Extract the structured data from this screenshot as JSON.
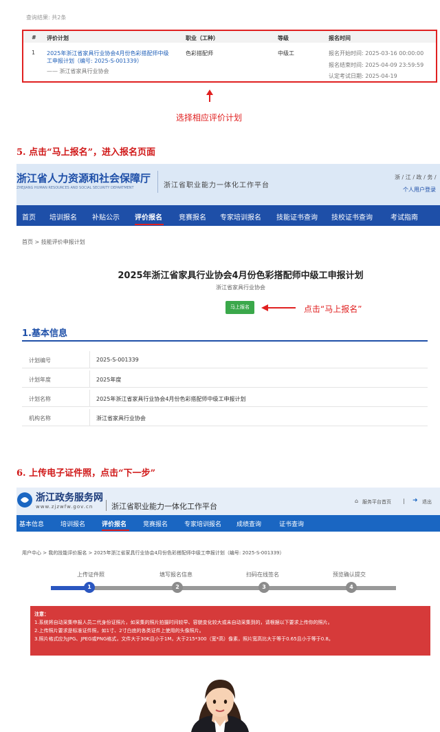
{
  "result": {
    "count_label": "查询结果: 共2条",
    "headers": [
      "#",
      "评价计划",
      "职业（工种）",
      "等级",
      "报名时间"
    ],
    "row": {
      "index": "1",
      "plan_line1": "2025年浙江省家具行业协会4月份色彩搭配师中级",
      "plan_line2": "工申报计划（编号: 2025-S-001339）",
      "org": "—— 浙江省家具行业协会",
      "occupation": "色彩搭配师",
      "level": "中级工",
      "time1": "报名开始时间: 2025-03-16 00:00:00",
      "time2": "报名结束时间: 2025-04-09 23:59:59",
      "time3": "认定考试日期: 2025-04-19"
    },
    "annotation": "选择相应评价计划"
  },
  "step5": {
    "title": "5.  点击“马上报名”，进入报名页面",
    "header": {
      "org_name": "浙江省人力资源和社会保障厅",
      "org_en": "ZHEJIANG HUMAN RESOURCES AND SOCIAL SECURITY DEPARTMENT",
      "platform": "浙江省职业能力一体化工作平台",
      "gov_links": "浙 / 江 / 政 / 务 /",
      "login": "个人用户登录"
    },
    "nav": [
      "首页",
      "培训报名",
      "补贴公示",
      "评价报名",
      "竞赛报名",
      "专家培训报名",
      "技能证书查询",
      "技校证书查询",
      "考试指南"
    ],
    "breadcrumb": "首页 > 技能评价申报计划",
    "page_title": "2025年浙江省家具行业协会4月份色彩搭配师中级工申报计划",
    "page_subtitle": "浙江省家具行业协会",
    "signup_button": "马上报名",
    "signup_annotation": "点击“马上报名”",
    "section_title": "1.基本信息",
    "info": [
      {
        "k": "计划编号",
        "v": "2025-S-001339"
      },
      {
        "k": "计划年度",
        "v": "2025年度"
      },
      {
        "k": "计划名称",
        "v": "2025年浙江省家具行业协会4月份色彩搭配师中级工申报计划"
      },
      {
        "k": "机构名称",
        "v": "浙江省家具行业协会"
      }
    ]
  },
  "step6": {
    "title": "6.  上传电子证件照，点击“下一步”",
    "header": {
      "site_name": "浙江政务服务网",
      "site_url": "www.zjzwfw.gov.cn",
      "platform": "浙江省职业能力一体化工作平台",
      "home_link": "服务平台首页",
      "logout": "退出"
    },
    "nav": [
      "基本信息",
      "培训报名",
      "评价报名",
      "竞赛报名",
      "专家培训报名",
      "成绩查询",
      "证书查询"
    ],
    "breadcrumb": "用户中心 > 我的技能评价报名 > 2025年浙江省家具行业协会4月份色彩搭配师中级工申报计划（编号: 2025-S-001339）",
    "steps": [
      {
        "label": "上传证件照",
        "num": "1"
      },
      {
        "label": "填写报名信息",
        "num": "2"
      },
      {
        "label": "扫码在线签名",
        "num": "3"
      },
      {
        "label": "预览确认提交",
        "num": "4"
      }
    ],
    "notice": {
      "title": "注意：",
      "line1": "1.系统将自动采集申报人员二代身份证照片，如采集的照片拍摄时间较早、容貌变化较大或未自动采集到的，请根据以下要求上传你的照片。",
      "line2": "2.上传照片要求是标准证件照，如1寸、2寸白底的各类证件上使用的头像照片。",
      "line3": "3.照片格式应为JPG、JPEG或PNG格式，文件大于30K且小于1M，大于215*300（宽*高）像素，照片宽高比大于等于0.65且小于等于0.8。"
    }
  }
}
